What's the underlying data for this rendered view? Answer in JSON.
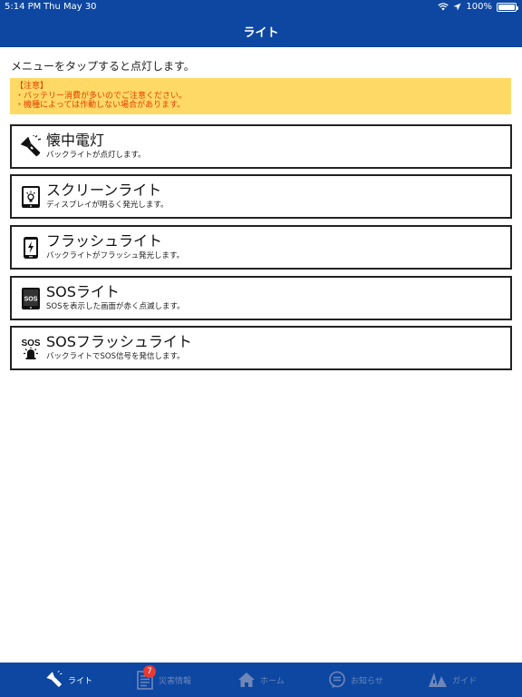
{
  "status_bar": {
    "time": "5:14 PM",
    "date": "Thu May 30",
    "battery": "100%"
  },
  "header": {
    "title": "ライト"
  },
  "instruction": "メニューをタップすると点灯します。",
  "notice": {
    "heading": "【注意】",
    "lines": [
      "・バッテリー消費が多いのでご注意ください。",
      "・機種によっては作動しない場合があります。"
    ]
  },
  "menu": [
    {
      "label": "懐中電灯",
      "desc": "バックライトが点灯します。",
      "icon": "flashlight-icon"
    },
    {
      "label": "スクリーンライト",
      "desc": "ディスプレイが明るく発光します。",
      "icon": "screen-light-icon"
    },
    {
      "label": "フラッシュライト",
      "desc": "バックライトがフラッシュ発光します。",
      "icon": "flash-icon"
    },
    {
      "label": "SOSライト",
      "desc": "SOSを表示した画面が赤く点滅します。",
      "icon": "sos-screen-icon",
      "icon_text": "SOS"
    },
    {
      "label": "SOSフラッシュライト",
      "desc": "バックライトでSOS信号を発信します。",
      "icon": "sos-beacon-icon",
      "icon_text": "SOS"
    }
  ],
  "tabs": [
    {
      "label": "ライト",
      "icon": "flashlight-icon",
      "active": true
    },
    {
      "label": "災害情報",
      "icon": "document-icon",
      "badge": "7"
    },
    {
      "label": "ホーム",
      "icon": "home-icon"
    },
    {
      "label": "お知らせ",
      "icon": "chat-icon"
    },
    {
      "label": "ガイド",
      "icon": "guide-icon"
    }
  ],
  "colors": {
    "bar": "#0d47a1",
    "notice_bg": "#ffd966",
    "notice_text": "#e53e00",
    "tab_inactive": "#6f86b8",
    "badge": "#e53935"
  }
}
